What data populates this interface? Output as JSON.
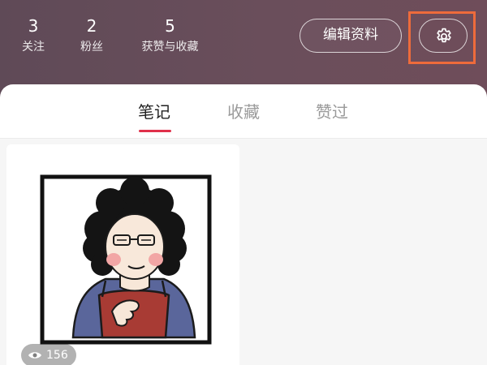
{
  "stats": {
    "following": {
      "count": "3",
      "label": "关注"
    },
    "fans": {
      "count": "2",
      "label": "粉丝"
    },
    "likes_collects": {
      "count": "5",
      "label": "获赞与收藏"
    }
  },
  "header": {
    "edit_label": "编辑资料",
    "settings_icon": "gear-icon",
    "highlight_color": "#ee6b3b"
  },
  "tabs": [
    {
      "label": "笔记",
      "active": true
    },
    {
      "label": "收藏",
      "active": false
    },
    {
      "label": "赞过",
      "active": false
    }
  ],
  "accent_color": "#e0314b",
  "feed": {
    "cards": [
      {
        "views": "156",
        "views_icon": "eye-icon"
      }
    ]
  }
}
